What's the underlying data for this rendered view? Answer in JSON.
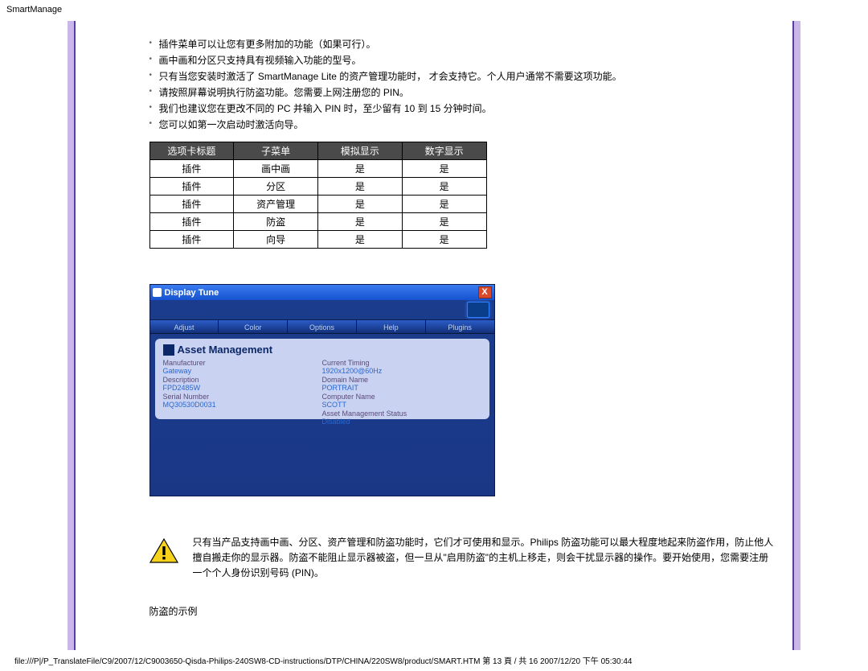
{
  "page_title": "SmartManage",
  "notes": [
    "插件菜单可以让您有更多附加的功能（如果可行）。",
    "画中画和分区只支持具有视频输入功能的型号。",
    "只有当您安装时激活了 SmartManage Lite 的资产管理功能时， 才会支持它。个人用户通常不需要这项功能。",
    "请按照屏幕说明执行防盗功能。您需要上网注册您的 PIN。",
    "我们也建议您在更改不同的 PC 并输入 PIN 时，至少留有 10 到 15 分钟时间。",
    "您可以如第一次启动时激活向导。"
  ],
  "table": {
    "head": [
      "选项卡标题",
      "子菜单",
      "模拟显示",
      "数字显示"
    ],
    "rows": [
      [
        "插件",
        "画中画",
        "是",
        "是"
      ],
      [
        "插件",
        "分区",
        "是",
        "是"
      ],
      [
        "插件",
        "资产管理",
        "是",
        "是"
      ],
      [
        "插件",
        "防盗",
        "是",
        "是"
      ],
      [
        "插件",
        "向导",
        "是",
        "是"
      ]
    ]
  },
  "shot": {
    "title": "Display Tune",
    "close": "X",
    "tabs": [
      "Adjust",
      "Color",
      "Options",
      "Help",
      "Plugins"
    ],
    "panel_title": "Asset Management",
    "left": [
      {
        "lab": "Manufacturer",
        "val": "Gateway"
      },
      {
        "lab": "Description",
        "val": "FPD2485W"
      },
      {
        "lab": "Serial Number",
        "val": "MQ30530D0031"
      }
    ],
    "right": [
      {
        "lab": "Current Timing",
        "val": "1920x1200@60Hz"
      },
      {
        "lab": "Domain Name",
        "val": "PORTRAIT"
      },
      {
        "lab": "Computer Name",
        "val": "SCOTT"
      },
      {
        "lab": "Asset Management Status",
        "val": "Disabled"
      }
    ]
  },
  "warning": "只有当产品支持画中画、分区、资产管理和防盗功能时，它们才可使用和显示。Philips 防盗功能可以最大程度地起来防盗作用，防止他人擅自搬走你的显示器。防盗不能阻止显示器被盗，但一旦从\"启用防盗\"的主机上移走，则会干扰显示器的操作。要开始使用，您需要注册一个个人身份识别号码 (PIN)。",
  "subheading": "防盗的示例",
  "footer": "file:///P|/P_TranslateFile/C9/2007/12/C9003650-Qisda-Philips-240SW8-CD-instructions/DTP/CHINA/220SW8/product/SMART.HTM 第 13 頁 / 共 16 2007/12/20 下午 05:30:44"
}
